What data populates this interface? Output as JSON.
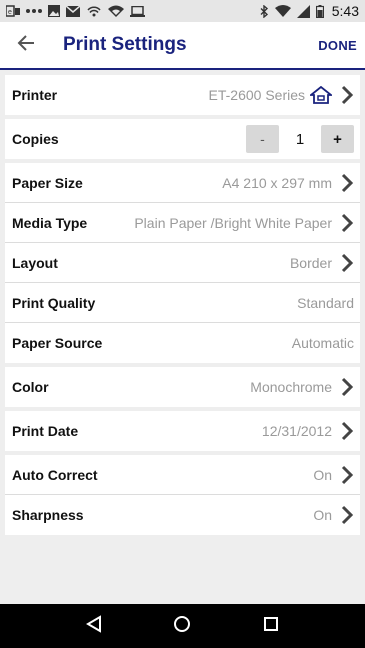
{
  "status_bar": {
    "time": "5:43",
    "left_icons": [
      "app-notification-icon",
      "more-dots-icon",
      "image-icon",
      "mail-icon",
      "wifi-print-icon",
      "wifi-icon",
      "laptop-icon"
    ],
    "right_icons": [
      "bluetooth-icon",
      "wifi-signal-icon",
      "cell-signal-icon",
      "battery-icon"
    ]
  },
  "header": {
    "title": "Print Settings",
    "done_label": "DONE"
  },
  "settings": {
    "printer": {
      "label": "Printer",
      "value": "ET-2600 Series"
    },
    "copies": {
      "label": "Copies",
      "value": "1",
      "minus": "-",
      "plus": "+"
    },
    "paper_size": {
      "label": "Paper Size",
      "value": "A4 210 x 297 mm"
    },
    "media_type": {
      "label": "Media Type",
      "value": "Plain Paper /Bright White Paper"
    },
    "layout": {
      "label": "Layout",
      "value": "Border"
    },
    "print_quality": {
      "label": "Print Quality",
      "value": "Standard"
    },
    "paper_source": {
      "label": "Paper Source",
      "value": "Automatic"
    },
    "color": {
      "label": "Color",
      "value": "Monochrome"
    },
    "print_date": {
      "label": "Print Date",
      "value": "12/31/2012"
    },
    "auto_correct": {
      "label": "Auto Correct",
      "value": "On"
    },
    "sharpness": {
      "label": "Sharpness",
      "value": "On"
    }
  },
  "colors": {
    "accent": "#1a237e",
    "value_text": "#9a9a9a",
    "background": "#eeeeee"
  }
}
